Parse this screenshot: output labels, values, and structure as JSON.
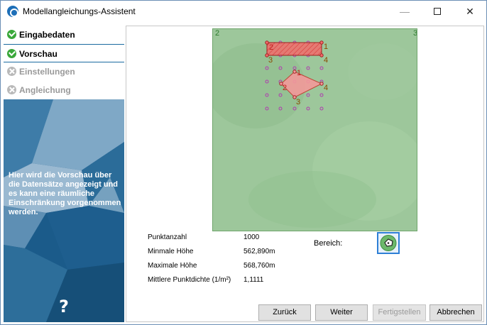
{
  "window": {
    "title": "Modellangleichungs-Assistent",
    "minimize_glyph": "—",
    "close_glyph": "✕"
  },
  "steps": [
    {
      "label": "Eingabedaten",
      "status": "done"
    },
    {
      "label": "Vorschau",
      "status": "done"
    },
    {
      "label": "Einstellungen",
      "status": "disabled"
    },
    {
      "label": "Angleichung",
      "status": "disabled"
    }
  ],
  "sidebar": {
    "description": "Hier wird die Vorschau über die Datensätze angezeigt und es kann eine räumliche Einschränkung vorgenommen werden.",
    "help_glyph": "?"
  },
  "map": {
    "corner_labels": [
      "2",
      "3"
    ],
    "polygon_labels": [
      "1",
      "2",
      "3",
      "4"
    ],
    "colors": {
      "terrain": "#9dc79b",
      "polygon_fill": "#f26c6c",
      "polygon_stroke": "#c0392b",
      "point": "#b03ab0",
      "label": "#a05a00"
    }
  },
  "stats": [
    {
      "label": "Punktanzahl",
      "value": "1000"
    },
    {
      "label": "Minmale Höhe",
      "value": "562,890m"
    },
    {
      "label": "Maximale Höhe",
      "value": "568,760m"
    },
    {
      "label": "Mittlere Punktdichte (1/m²)",
      "value": "1,1111"
    }
  ],
  "bereich": {
    "label": "Bereich:",
    "icon": "area-select-icon"
  },
  "buttons": {
    "back": "Zurück",
    "next": "Weiter",
    "finish": "Fertigstellen",
    "cancel": "Abbrechen"
  }
}
